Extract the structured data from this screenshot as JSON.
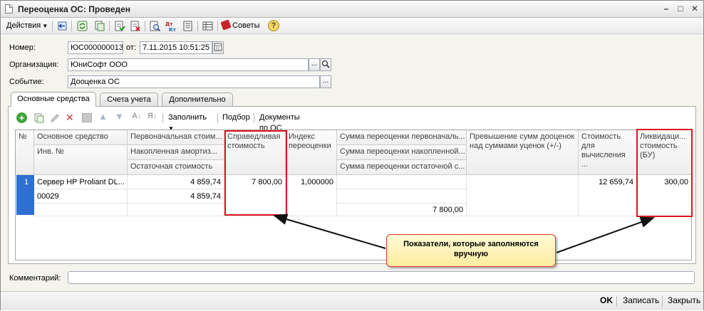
{
  "window": {
    "title": "Переоценка ОС: Проведен"
  },
  "toolbar": {
    "actions": "Действия",
    "tips": "Советы"
  },
  "form": {
    "number_label": "Номер:",
    "number_value": "ЮС000000013",
    "from_label": "от:",
    "date_value": "7.11.2015 10:51:25",
    "org_label": "Организация:",
    "org_value": "ЮниСофт ООО",
    "event_label": "Событие:",
    "event_value": "Дооценка ОС",
    "ellipsis": "...",
    "comment_label": "Комментарий:",
    "comment_value": ""
  },
  "tabs": [
    {
      "label": "Основные средства"
    },
    {
      "label": "Счета учета"
    },
    {
      "label": "Дополнительно"
    }
  ],
  "panel_toolbar": {
    "fill": "Заполнить",
    "select": "Подбор",
    "docs": "Документы по ОС"
  },
  "grid": {
    "headers": {
      "num": "№",
      "asset": "Основное средство",
      "inv": "Инв. №",
      "initial_cost": "Первоначальная стоим...",
      "accum_amort": "Накопленная амортиз...",
      "residual_cost": "Остаточная стоимость",
      "fair_value": "Справедливая стоимость",
      "index": "Индекс переоценки",
      "reval_initial": "Сумма переоценки первоначаль...",
      "reval_accum": "Сумма переоценки накопленной...",
      "reval_residual": "Сумма переоценки остаточной с...",
      "excess": "Превышение сумм дооценок над суммами уценок (+/-)",
      "calc_cost": "Стоимость для вычисления ...",
      "liquidation": "Ликвидаци... стоимость (БУ)"
    },
    "row": {
      "num": "1",
      "asset": "Сервер HP Proliant DL...",
      "inv": "00029",
      "initial_cost": "4 859,74",
      "accum_amort": "4 859,74",
      "fair_value": "7 800,00",
      "index": "1,000000",
      "reval_residual": "7 800,00",
      "calc_cost": "12 659,74",
      "liquidation": "300,00"
    }
  },
  "callout": {
    "text": "Показатели, которые заполняются вручную"
  },
  "bottom": {
    "ok": "OK",
    "save": "Записать",
    "close": "Закрыть"
  },
  "colors": {
    "highlight": "#e0141c",
    "selection": "#2f6fd1",
    "callout_bg": "#fff3b8"
  }
}
